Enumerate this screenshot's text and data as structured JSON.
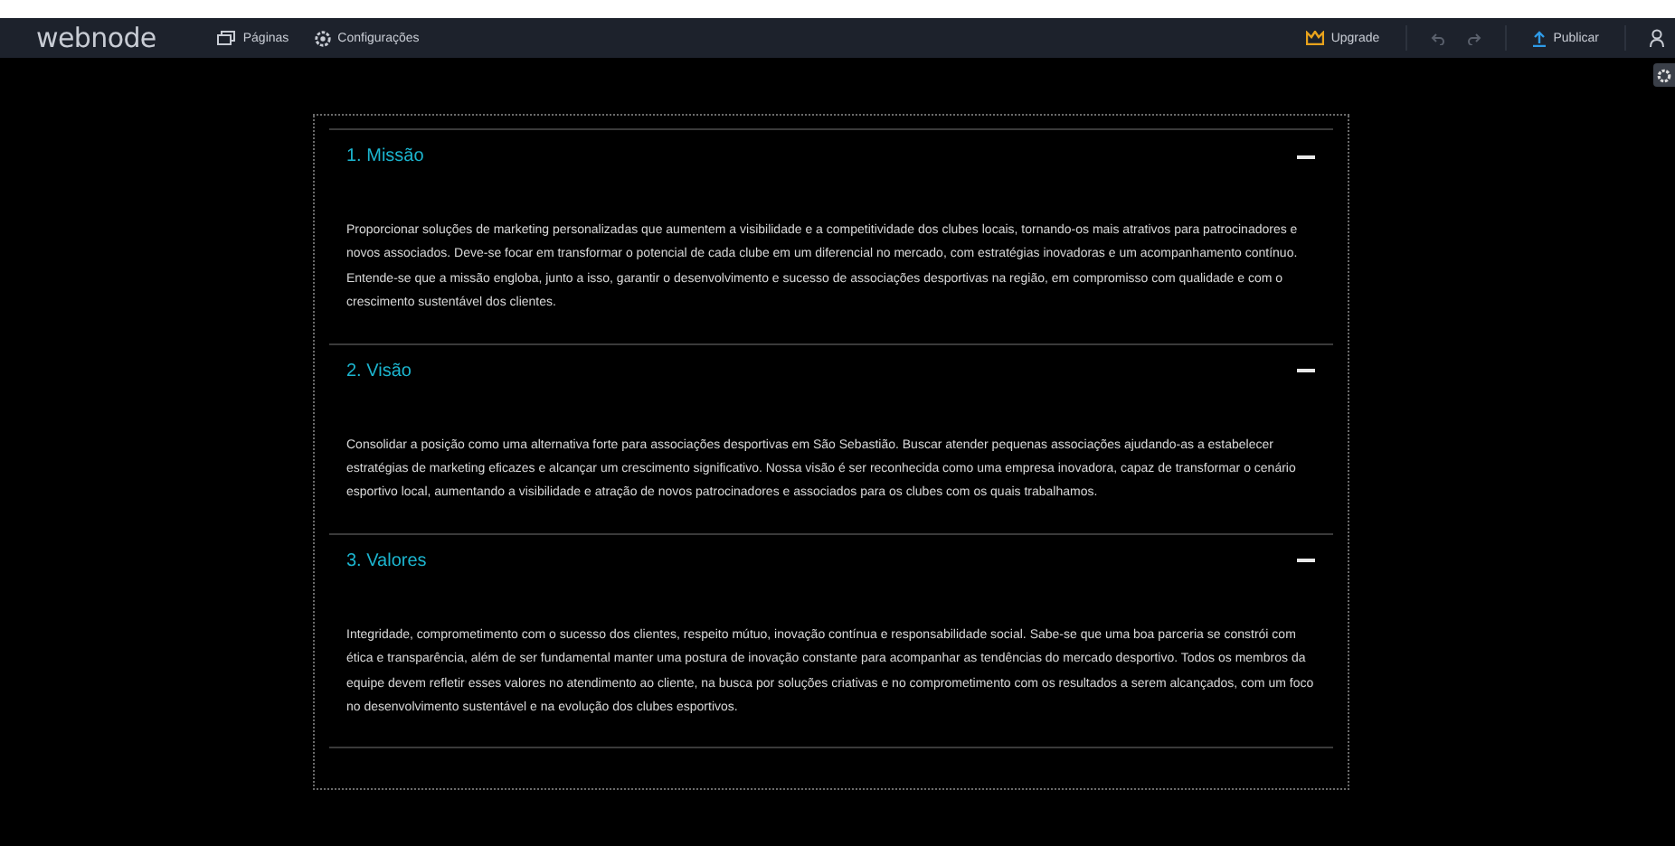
{
  "topbar": {
    "logo": "webnode",
    "nav": [
      {
        "kind": "pages",
        "label": "Páginas"
      },
      {
        "kind": "settings",
        "label": "Configurações"
      }
    ],
    "upgrade": "Upgrade",
    "publish": "Publicar"
  },
  "accordion": [
    {
      "title": "1. Missão",
      "expanded": true,
      "text": "Proporcionar soluções de marketing personalizadas que aumentem a visibilidade e a competitividade dos clubes locais, tornando-os mais atrativos para patrocinadores e novos associados. Deve-se focar em transformar o potencial de cada clube em um diferencial no mercado, com estratégias inovadoras e um acompanhamento contínuo. Entende-se que a missão engloba, junto a isso, garantir o desenvolvimento e sucesso de associações desportivas na região, em compromisso com qualidade e com o crescimento sustentável dos clientes."
    },
    {
      "title": "2. Visão",
      "expanded": true,
      "text": "Consolidar a posição como uma alternativa forte para associações desportivas em São Sebastião. Buscar atender pequenas associações ajudando-as a estabelecer estratégias de marketing eficazes e alcançar um crescimento significativo. Nossa visão é ser reconhecida como uma empresa inovadora, capaz de transformar o cenário esportivo local, aumentando a visibilidade e atração de novos patrocinadores e associados para os clubes com os quais trabalhamos."
    },
    {
      "title": "3. Valores",
      "expanded": true,
      "text": "Integridade, comprometimento com o sucesso dos clientes, respeito mútuo, inovação contínua e responsabilidade social. Sabe-se que uma boa parceria se constrói com ética e transparência, além de ser fundamental manter uma postura de inovação constante para acompanhar as tendências do mercado desportivo. Todos os membros da equipe devem refletir esses valores no atendimento ao cliente, na busca por soluções criativas e no comprometimento com os resultados a serem alcançados, com um foco no desenvolvimento sustentável e na evolução dos clubes esportivos."
    }
  ]
}
